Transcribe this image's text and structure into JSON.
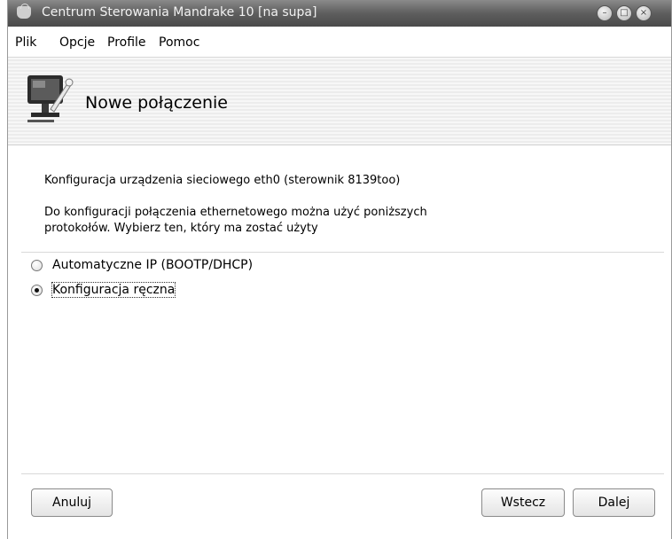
{
  "window": {
    "title": "Centrum Sterowania Mandrake 10 [na supa]"
  },
  "menubar": {
    "items": [
      "Plik",
      "Opcje",
      "Profile",
      "Pomoc"
    ]
  },
  "header": {
    "title": "Nowe połączenie",
    "icon": "network-monitor-wrench-icon"
  },
  "content": {
    "device_line": "Konfiguracja urządzenia sieciowego eth0 (sterownik 8139too)",
    "description_line1": "Do konfiguracji połączenia ethernetowego można użyć poniższych",
    "description_line2": "protokołów. Wybierz ten, który ma zostać użyty",
    "options": [
      {
        "label": "Automatyczne IP (BOOTP/DHCP)",
        "selected": false
      },
      {
        "label": "Konfiguracja ręczna",
        "selected": true
      }
    ]
  },
  "buttons": {
    "cancel": "Anuluj",
    "back": "Wstecz",
    "next": "Dalej"
  },
  "colors": {
    "titlebar": "#5e5e5e",
    "background": "#ffffff"
  }
}
